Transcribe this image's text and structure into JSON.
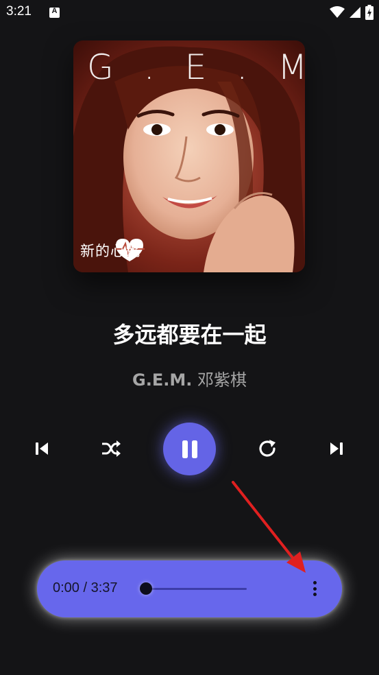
{
  "status_bar": {
    "time": "3:21",
    "notification_icon": "A",
    "icons": [
      "wifi-icon",
      "signal-icon",
      "battery-icon"
    ]
  },
  "album": {
    "brand_text": "G.E.M.",
    "album_title": "新的心跳",
    "icon": "album-cover"
  },
  "track": {
    "title": "多远都要在一起",
    "artist_latin": "G.E.M.",
    "artist_chinese": "邓紫棋"
  },
  "controls": {
    "previous": "skip-previous-icon",
    "shuffle": "shuffle-icon",
    "play_pause": "pause-icon",
    "repeat": "repeat-icon",
    "next": "skip-next-icon"
  },
  "progress": {
    "position": "0:00",
    "duration": "3:37",
    "display": "0:00 / 3:37",
    "fraction": 0.0
  },
  "colors": {
    "background": "#141416",
    "accent": "#6464e6",
    "player_bar": "#6767ec",
    "annotation_arrow": "#e02020"
  }
}
